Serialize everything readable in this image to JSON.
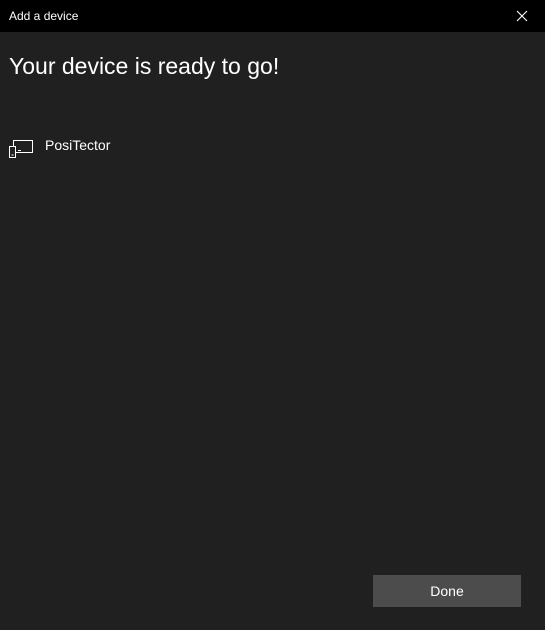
{
  "window": {
    "title": "Add a device"
  },
  "header": {
    "title": "Your device is ready to go!"
  },
  "devices": [
    {
      "name": "PosiTector",
      "icon": "device-icon"
    }
  ],
  "footer": {
    "done_label": "Done"
  },
  "icons": {
    "close": "close-icon",
    "device": "device-icon"
  },
  "colors": {
    "background": "#202020",
    "titlebar": "#000000",
    "button": "#4c4c4c",
    "text": "#ffffff"
  }
}
